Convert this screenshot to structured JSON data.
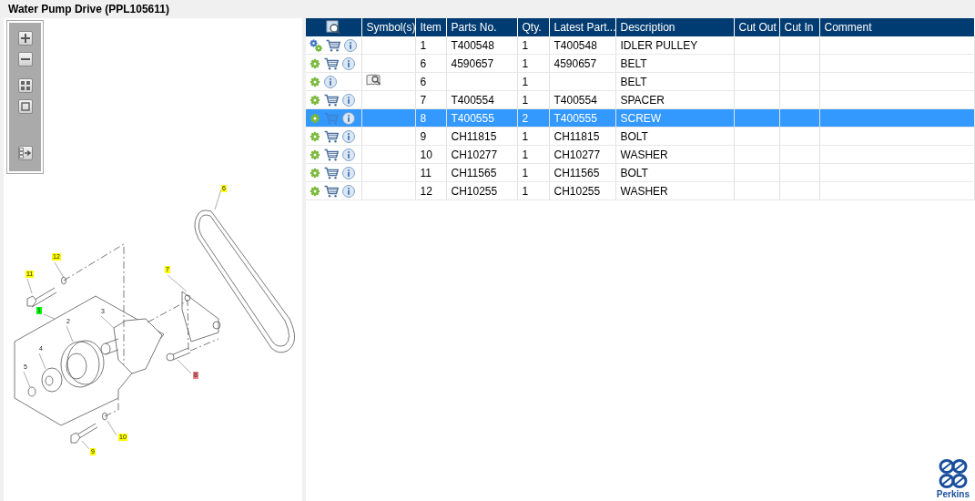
{
  "title": "Water Pump Drive (PPL105611)",
  "diagram": {
    "callouts": [
      {
        "label": "6",
        "color": "#ffff00"
      },
      {
        "label": "7",
        "color": "#ffff00"
      },
      {
        "label": "12",
        "color": "#ffff00"
      },
      {
        "label": "11",
        "color": "#ffff00"
      },
      {
        "label": "1",
        "color": "#00ff00"
      },
      {
        "label": "2"
      },
      {
        "label": "3"
      },
      {
        "label": "4"
      },
      {
        "label": "5"
      },
      {
        "label": "8",
        "color": "#f08080"
      },
      {
        "label": "10",
        "color": "#ffff00"
      },
      {
        "label": "9",
        "color": "#ffff00"
      }
    ]
  },
  "table": {
    "columns": [
      "Symbol(s)",
      "Item",
      "Parts No.",
      "Qty.",
      "Latest Part...",
      "Description",
      "Cut Out",
      "Cut In",
      "Comment"
    ],
    "rows": [
      {
        "kind": "multi",
        "cart": true,
        "symbol": false,
        "item": "1",
        "part_no": "T400548",
        "qty": "1",
        "latest": "T400548",
        "description": "IDLER PULLEY",
        "selected": false
      },
      {
        "kind": "single",
        "cart": true,
        "symbol": false,
        "item": "6",
        "part_no": "4590657",
        "qty": "1",
        "latest": "4590657",
        "description": "BELT",
        "selected": false
      },
      {
        "kind": "single",
        "cart": false,
        "symbol": true,
        "item": "6",
        "qty": "1",
        "description": "BELT",
        "selected": false
      },
      {
        "kind": "single",
        "cart": true,
        "symbol": false,
        "item": "7",
        "part_no": "T400554",
        "qty": "1",
        "latest": "T400554",
        "description": "SPACER",
        "selected": false
      },
      {
        "kind": "single",
        "cart": true,
        "symbol": false,
        "item": "8",
        "part_no": "T400555",
        "qty": "2",
        "latest": "T400555",
        "description": "SCREW",
        "selected": true
      },
      {
        "kind": "single",
        "cart": true,
        "symbol": false,
        "item": "9",
        "part_no": "CH11815",
        "qty": "1",
        "latest": "CH11815",
        "description": "BOLT",
        "selected": false
      },
      {
        "kind": "single",
        "cart": true,
        "symbol": false,
        "item": "10",
        "part_no": "CH10277",
        "qty": "1",
        "latest": "CH10277",
        "description": "WASHER",
        "selected": false
      },
      {
        "kind": "single",
        "cart": true,
        "symbol": false,
        "item": "11",
        "part_no": "CH11565",
        "qty": "1",
        "latest": "CH11565",
        "description": "BOLT",
        "selected": false
      },
      {
        "kind": "single",
        "cart": true,
        "symbol": false,
        "item": "12",
        "part_no": "CH10255",
        "qty": "1",
        "latest": "CH10255",
        "description": "WASHER",
        "selected": false
      }
    ]
  },
  "logo": {
    "text": "Perkins"
  }
}
